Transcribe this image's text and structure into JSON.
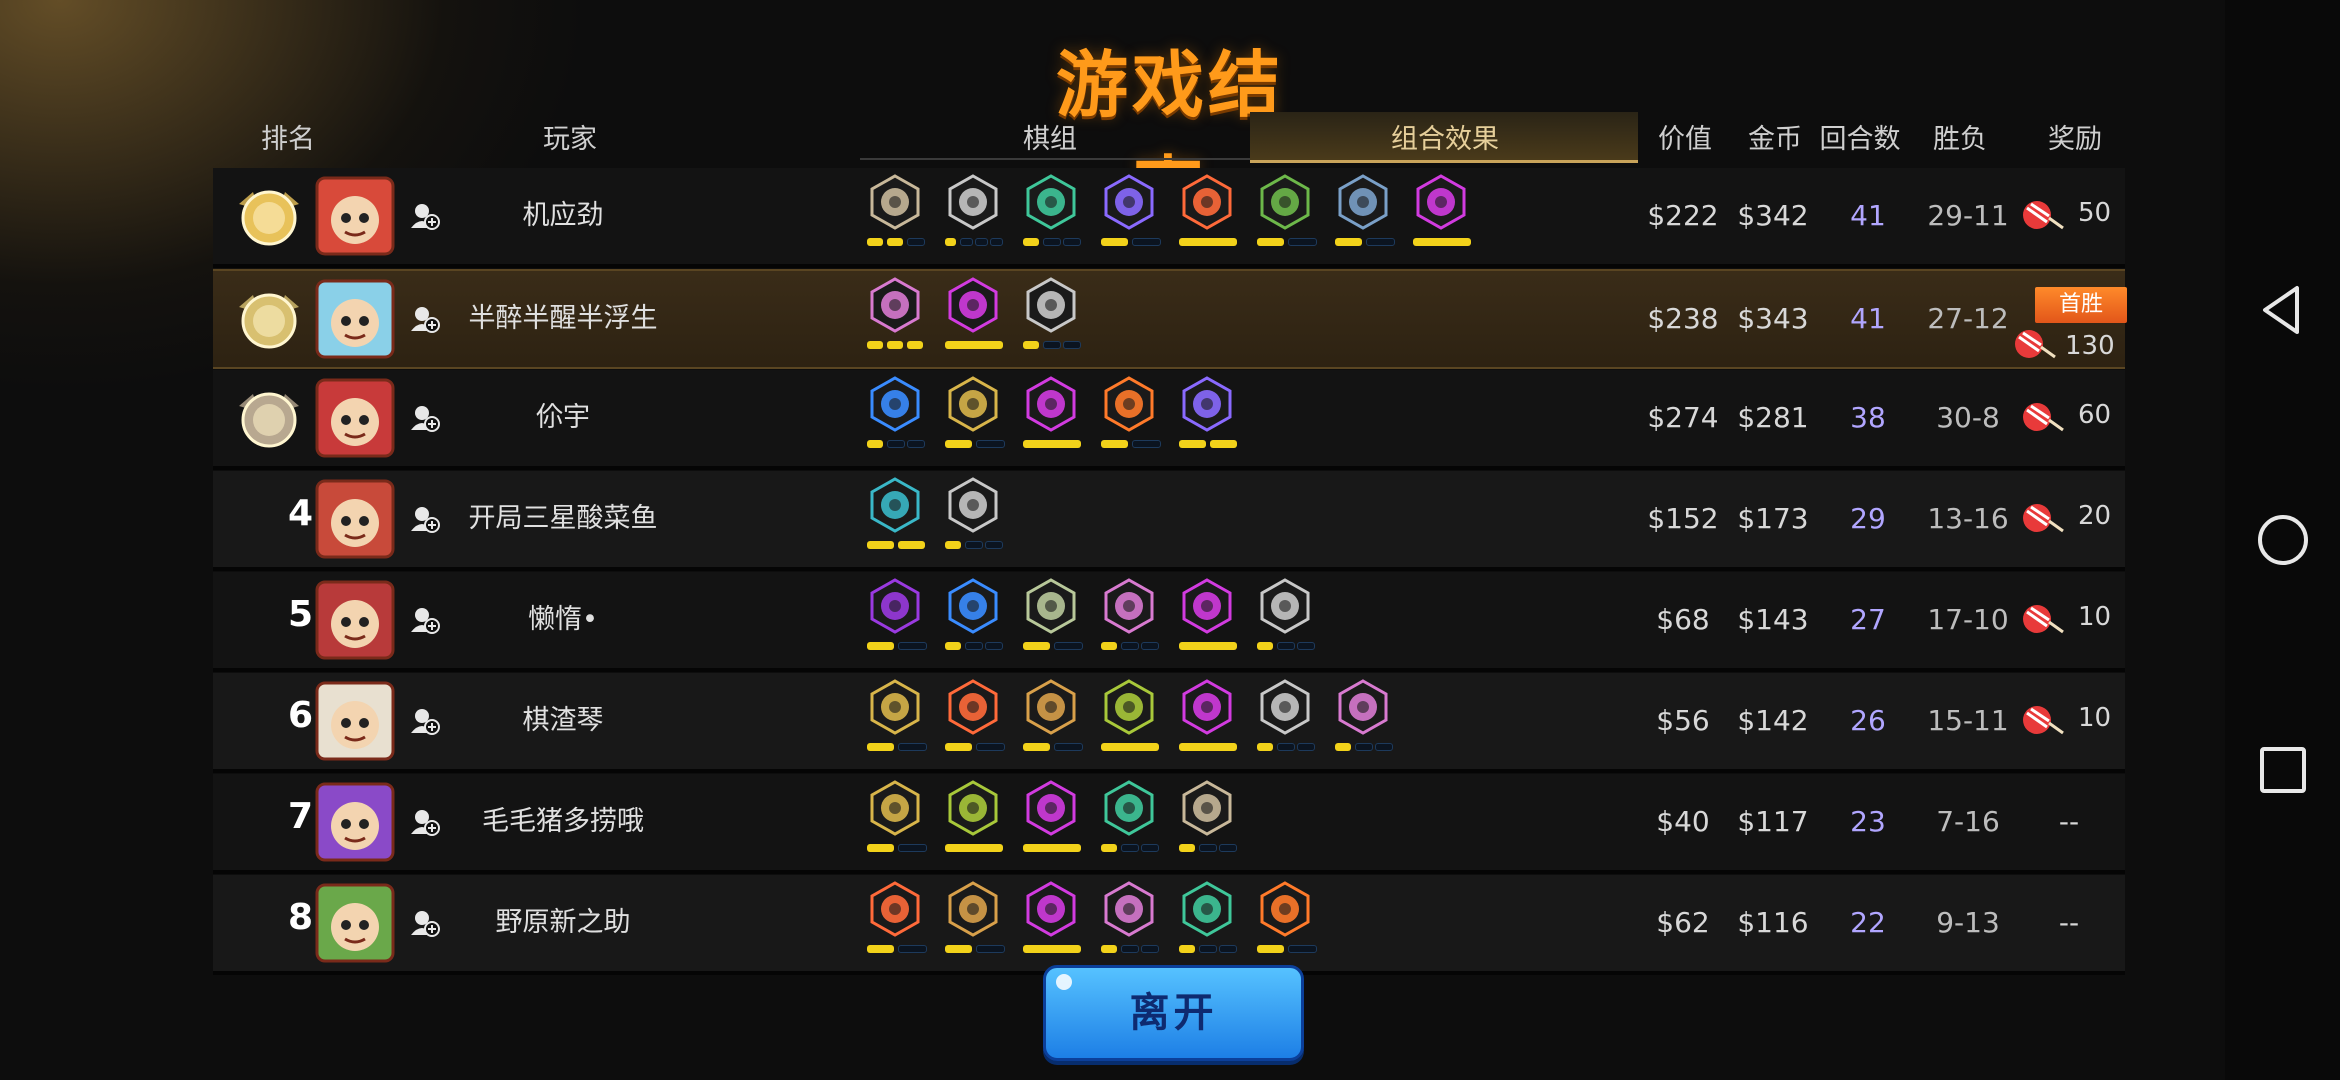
{
  "title": "游戏结束",
  "headers": {
    "rank": "排名",
    "player": "玩家",
    "board": "棋组",
    "combo": "组合效果",
    "value": "价值",
    "gold": "金币",
    "rounds": "回合数",
    "winloss": "胜负",
    "reward": "奖励"
  },
  "players": [
    {
      "rank": "1",
      "name": "机应劲",
      "value": "$222",
      "gold": "$342",
      "rounds": "41",
      "winloss": "29-11",
      "reward": "50",
      "traits": [
        {
          "icon": "axe-icon",
          "color": "#c8b89a",
          "bars": [
            1,
            1,
            0
          ]
        },
        {
          "icon": "helmet-icon",
          "color": "#c8c8c8",
          "bars": [
            1,
            0,
            0,
            0
          ]
        },
        {
          "icon": "paw-icon",
          "color": "#3fc79a",
          "bars": [
            1,
            0,
            0
          ]
        },
        {
          "icon": "fishbone-icon",
          "color": "#8a6aff",
          "bars": [
            1,
            0
          ]
        },
        {
          "icon": "viking-icon",
          "color": "#ff6a3a",
          "bars": [
            2
          ]
        },
        {
          "icon": "bow-icon",
          "color": "#6db84a",
          "bars": [
            1,
            0
          ]
        },
        {
          "icon": "dice-icon",
          "color": "#7aa0c8",
          "bars": [
            1,
            0
          ]
        },
        {
          "icon": "demon-icon",
          "color": "#d23be0",
          "bars": [
            2
          ]
        }
      ]
    },
    {
      "rank": "2",
      "name": "半醉半醒半浮生",
      "value": "$238",
      "gold": "$343",
      "rounds": "41",
      "winloss": "27-12",
      "reward": "130",
      "first_win": "首胜",
      "traits": [
        {
          "icon": "knight-icon",
          "color": "#d87ad0",
          "bars": [
            1,
            1,
            1
          ]
        },
        {
          "icon": "demon-icon",
          "color": "#d23be0",
          "bars": [
            2
          ]
        },
        {
          "icon": "helmet-icon",
          "color": "#c8c8c8",
          "bars": [
            1,
            0,
            0
          ]
        }
      ]
    },
    {
      "rank": "3",
      "name": "伱宇",
      "value": "$274",
      "gold": "$281",
      "rounds": "38",
      "winloss": "30-8",
      "reward": "60",
      "traits": [
        {
          "icon": "feather-icon",
          "color": "#3a8cff",
          "bars": [
            1,
            0,
            0
          ]
        },
        {
          "icon": "sword-icon",
          "color": "#d8b54a",
          "bars": [
            1,
            0
          ]
        },
        {
          "icon": "demon-icon",
          "color": "#d23be0",
          "bars": [
            2
          ]
        },
        {
          "icon": "leaf-icon",
          "color": "#ff7a2a",
          "bars": [
            1,
            0
          ]
        },
        {
          "icon": "fishbone-icon",
          "color": "#8a6aff",
          "bars": [
            1,
            1
          ]
        }
      ]
    },
    {
      "rank": "4",
      "name": "开局三星酸菜鱼",
      "value": "$152",
      "gold": "$173",
      "rounds": "29",
      "winloss": "13-16",
      "reward": "20",
      "traits": [
        {
          "icon": "mystic-icon",
          "color": "#3ab8c8",
          "bars": [
            1,
            1
          ]
        },
        {
          "icon": "helmet-icon",
          "color": "#c8c8c8",
          "bars": [
            1,
            0,
            0
          ]
        }
      ]
    },
    {
      "rank": "5",
      "name": "懒惰•",
      "value": "$68",
      "gold": "$143",
      "rounds": "27",
      "winloss": "17-10",
      "reward": "10",
      "traits": [
        {
          "icon": "wraith-icon",
          "color": "#9a3ae0",
          "bars": [
            1,
            0
          ]
        },
        {
          "icon": "feather-icon",
          "color": "#3a8cff",
          "bars": [
            1,
            0,
            0
          ]
        },
        {
          "icon": "totem-icon",
          "color": "#b8c89a",
          "bars": [
            1,
            0
          ]
        },
        {
          "icon": "knight-icon",
          "color": "#d87ad0",
          "bars": [
            1,
            0,
            0
          ]
        },
        {
          "icon": "demon-icon",
          "color": "#d23be0",
          "bars": [
            2
          ]
        },
        {
          "icon": "helmet-icon",
          "color": "#c8c8c8",
          "bars": [
            1,
            0,
            0
          ]
        }
      ]
    },
    {
      "rank": "6",
      "name": "棋渣琴",
      "value": "$56",
      "gold": "$142",
      "rounds": "26",
      "winloss": "15-11",
      "reward": "10",
      "traits": [
        {
          "icon": "sword-icon",
          "color": "#d8b54a",
          "bars": [
            1,
            0
          ]
        },
        {
          "icon": "ogre-icon",
          "color": "#ff6a3a",
          "bars": [
            1,
            0
          ]
        },
        {
          "icon": "gear-icon",
          "color": "#d8a04a",
          "bars": [
            1,
            0
          ]
        },
        {
          "icon": "rocks-icon",
          "color": "#a8c83a",
          "bars": [
            2
          ]
        },
        {
          "icon": "demon-icon",
          "color": "#d23be0",
          "bars": [
            2
          ]
        },
        {
          "icon": "helmet-icon",
          "color": "#c8c8c8",
          "bars": [
            1,
            0,
            0
          ]
        },
        {
          "icon": "knight-icon",
          "color": "#d87ad0",
          "bars": [
            1,
            0,
            0
          ]
        }
      ]
    },
    {
      "rank": "7",
      "name": "毛毛猪多捞哦",
      "value": "$40",
      "gold": "$117",
      "rounds": "23",
      "winloss": "7-16",
      "reward": "--",
      "traits": [
        {
          "icon": "sword-icon",
          "color": "#d8b54a",
          "bars": [
            1,
            0
          ]
        },
        {
          "icon": "rocks-icon",
          "color": "#a8c83a",
          "bars": [
            2
          ]
        },
        {
          "icon": "demon-icon",
          "color": "#d23be0",
          "bars": [
            2
          ]
        },
        {
          "icon": "paw-icon",
          "color": "#3fc79a",
          "bars": [
            1,
            0,
            0
          ]
        },
        {
          "icon": "axe-icon",
          "color": "#c8b89a",
          "bars": [
            1,
            0,
            0
          ]
        }
      ]
    },
    {
      "rank": "8",
      "name": "野原新之助",
      "value": "$62",
      "gold": "$116",
      "rounds": "22",
      "winloss": "9-13",
      "reward": "--",
      "traits": [
        {
          "icon": "ogre-icon",
          "color": "#ff6a3a",
          "bars": [
            1,
            0
          ]
        },
        {
          "icon": "gear-icon",
          "color": "#d8a04a",
          "bars": [
            1,
            0
          ]
        },
        {
          "icon": "demon-icon",
          "color": "#d23be0",
          "bars": [
            2
          ]
        },
        {
          "icon": "knight-icon",
          "color": "#d87ad0",
          "bars": [
            1,
            0,
            0
          ]
        },
        {
          "icon": "paw-icon",
          "color": "#3fc79a",
          "bars": [
            1,
            0,
            0
          ]
        },
        {
          "icon": "leaf-icon",
          "color": "#ff7a2a",
          "bars": [
            1,
            0
          ]
        }
      ]
    }
  ],
  "leave_button": "离开",
  "colors": {
    "title": "#ff9a1a",
    "rounds": "#b1a6ff",
    "first_win": "#f0701e",
    "leave": "#2a96f0",
    "bar_on": "#f2d21a"
  }
}
